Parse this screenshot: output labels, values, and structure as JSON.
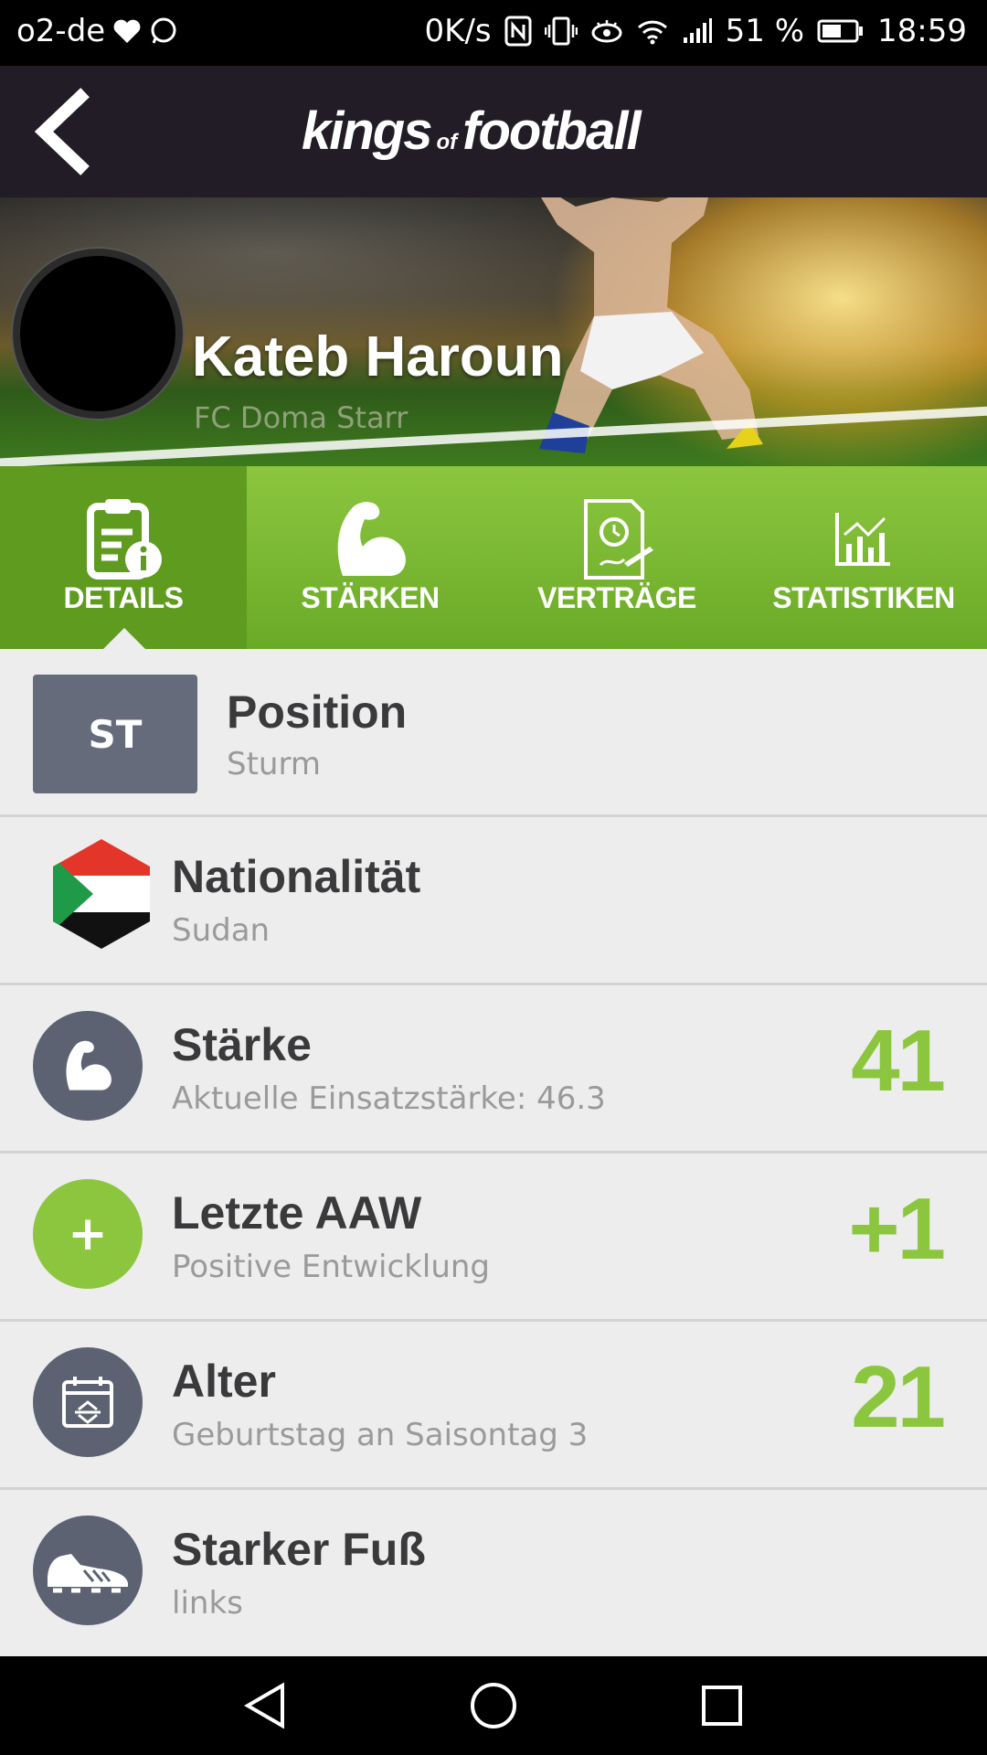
{
  "status_bar": {
    "carrier": "o2-de",
    "speed": "0K/s",
    "battery": "51 %",
    "time": "18:59"
  },
  "header": {
    "logo_kings": "kings",
    "logo_of": "of",
    "logo_football": "football"
  },
  "player": {
    "name": "Kateb Haroun",
    "club": "FC Doma Starr"
  },
  "tabs": [
    {
      "label": "DETAILS",
      "icon": "details-info-icon",
      "active": true
    },
    {
      "label": "STÄRKEN",
      "icon": "muscle-icon",
      "active": false
    },
    {
      "label": "VERTRÄGE",
      "icon": "contract-icon",
      "active": false
    },
    {
      "label": "STATISTIKEN",
      "icon": "chart-icon",
      "active": false
    }
  ],
  "details": {
    "position": {
      "badge": "ST",
      "title": "Position",
      "subtitle": "Sturm"
    },
    "nationality": {
      "title": "Nationalität",
      "subtitle": "Sudan",
      "icon": "sudan-flag-icon"
    },
    "strength": {
      "title": "Stärke",
      "subtitle": "Aktuelle Einsatzstärke: 46.3",
      "value": "41",
      "icon": "muscle-icon"
    },
    "last_aaw": {
      "title": "Letzte AAW",
      "subtitle": "Positive Entwicklung",
      "value": "+1",
      "icon_glyph": "+"
    },
    "age": {
      "title": "Alter",
      "subtitle": "Geburtstag an Saisontag 3",
      "value": "21",
      "icon": "calendar-icon"
    },
    "strong_foot": {
      "title": "Starker Fuß",
      "subtitle": "links",
      "icon": "boot-icon"
    }
  },
  "colors": {
    "accent_green": "#8cc63f",
    "header_bg": "#211c26",
    "icon_gray": "#5c6272"
  }
}
